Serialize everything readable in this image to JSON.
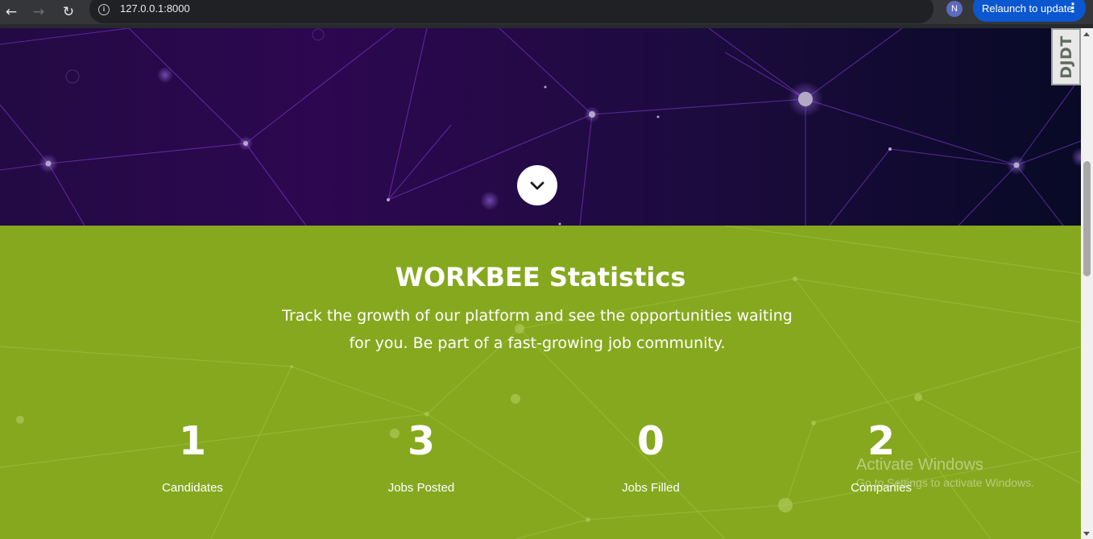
{
  "browser": {
    "url": "127.0.0.1:8000",
    "profile_initial": "N",
    "relaunch_label": "Relaunch to update",
    "icons": {
      "back": "back-arrow-icon",
      "forward": "forward-arrow-icon",
      "reload": "reload-icon",
      "site_info": "site-info-icon",
      "bookmark": "star-icon",
      "menu": "kebab-menu-icon"
    },
    "colors": {
      "relaunch_bg": "#0b57d0",
      "avatar_bg": "#5c6bc0"
    }
  },
  "hero": {
    "scroll_icon": "chevron-down-icon",
    "colors": {
      "bg_left": "#2d0750",
      "bg_right": "#080a26"
    }
  },
  "debug_toolbar": {
    "label": "DJDT"
  },
  "stats": {
    "title": "WORKBEE Statistics",
    "description": "Track the growth of our platform and see the opportunities waiting for you. Be part of a fast-growing job community.",
    "items": [
      {
        "value": "1",
        "label": "Candidates"
      },
      {
        "value": "3",
        "label": "Jobs Posted"
      },
      {
        "value": "0",
        "label": "Jobs Filled"
      },
      {
        "value": "2",
        "label": "Companies"
      }
    ],
    "colors": {
      "background": "#86a81f",
      "text": "#ffffff"
    }
  },
  "watermark": {
    "title": "Activate Windows",
    "subtitle": "Go to Settings to activate Windows."
  }
}
